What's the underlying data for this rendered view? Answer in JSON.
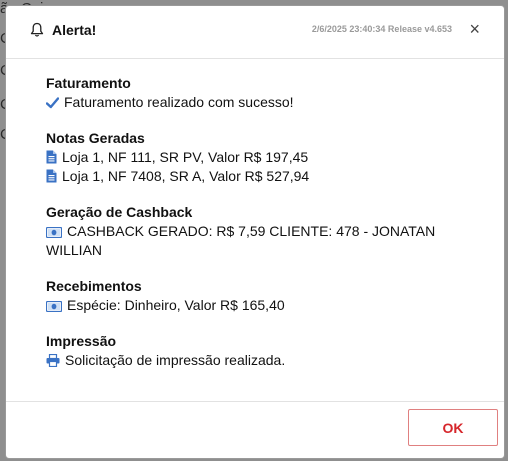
{
  "background": {
    "lines": [
      "ão Caixa",
      "Ca",
      "Ca",
      "Ca",
      "Ca"
    ]
  },
  "dialog": {
    "title": "Alerta!",
    "release": "2/6/2025 23:40:34 Release v4.653",
    "close_label": "×",
    "ok_label": "OK"
  },
  "sections": {
    "faturamento": {
      "title": "Faturamento",
      "items": [
        "Faturamento realizado com sucesso!"
      ]
    },
    "notas": {
      "title": "Notas Geradas",
      "items": [
        "Loja 1, NF 111, SR PV, Valor R$ 197,45",
        "Loja 1, NF 7408, SR A, Valor R$ 527,94"
      ]
    },
    "cashback": {
      "title": "Geração de Cashback",
      "items": [
        "CASHBACK GERADO: R$ 7,59 CLIENTE: 478 - JONATAN",
        "WILLIAN"
      ]
    },
    "recebimentos": {
      "title": "Recebimentos",
      "items": [
        "Espécie: Dinheiro, Valor R$ 165,40"
      ]
    },
    "impressao": {
      "title": "Impressão",
      "items": [
        "Solicitação de impressão realizada."
      ]
    }
  },
  "icons": {
    "bell": "bell-icon",
    "check": "check-icon",
    "document": "document-icon",
    "money": "money-icon",
    "printer": "printer-icon",
    "close": "close-icon"
  },
  "colors": {
    "accent": "#3a72c4",
    "ok_text": "#d6262b",
    "ok_border": "#e08080"
  }
}
